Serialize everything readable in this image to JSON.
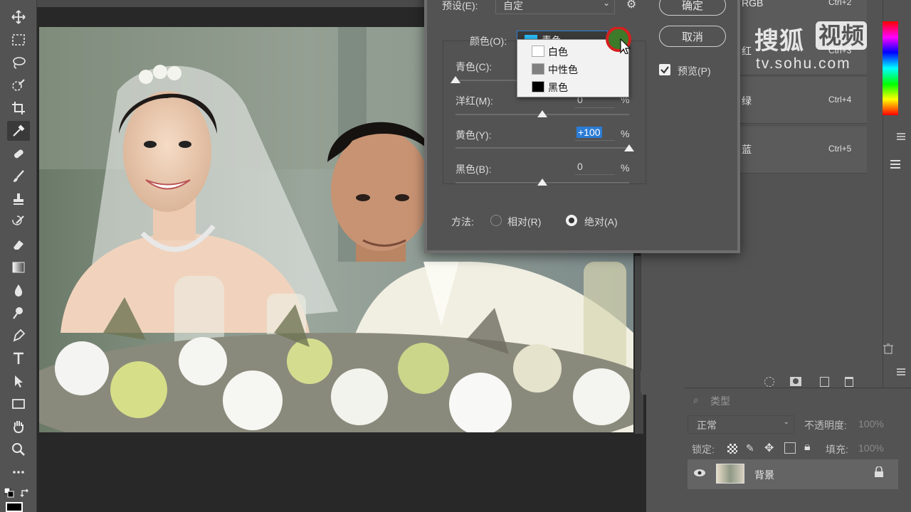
{
  "dialog": {
    "preset_label": "预设(E):",
    "preset_value": "自定",
    "ok_label": "确定",
    "cancel_label": "取消",
    "preview_label": "预览(P)",
    "color_label": "颜色(O):",
    "color_selected": "青色",
    "color_menu": [
      {
        "label": "白色",
        "swatch": "#ffffff"
      },
      {
        "label": "中性色",
        "swatch": "#808080"
      },
      {
        "label": "黑色",
        "swatch": "#000000"
      }
    ],
    "sliders": [
      {
        "label": "青色(C):",
        "value": "",
        "unit": "",
        "level": -100
      },
      {
        "label": "洋红(M):",
        "value": "0",
        "unit": "%",
        "level": 0
      },
      {
        "label": "黄色(Y):",
        "value": "+100",
        "unit": "%",
        "level": 100
      },
      {
        "label": "黑色(B):",
        "value": "0",
        "unit": "%",
        "level": 0
      }
    ],
    "method_label": "方法:",
    "method_relative": "相对(R)",
    "method_absolute": "绝对(A)",
    "method_selected": "absolute"
  },
  "channels": [
    {
      "name": "RGB",
      "key": "Ctrl+2"
    },
    {
      "name": "红",
      "key": "Ctrl+3"
    },
    {
      "name": "绿",
      "key": "Ctrl+4"
    },
    {
      "name": "蓝",
      "key": "Ctrl+5"
    }
  ],
  "layers": {
    "kind_label": "类型",
    "blend_mode": "正常",
    "opacity_label": "不透明度:",
    "opacity_value": "100%",
    "lock_label": "锁定:",
    "fill_label": "填充:",
    "fill_value": "100%",
    "layer_name": "背景"
  },
  "watermark": {
    "brand": "搜狐",
    "badge": "视频",
    "url": "tv.sohu.com"
  },
  "colors": {
    "accent": "#2c7cd4",
    "cyan_swatch": "#29b6f0",
    "cursor_ring": "#d42020",
    "cursor_fill": "#3d7a2a"
  }
}
